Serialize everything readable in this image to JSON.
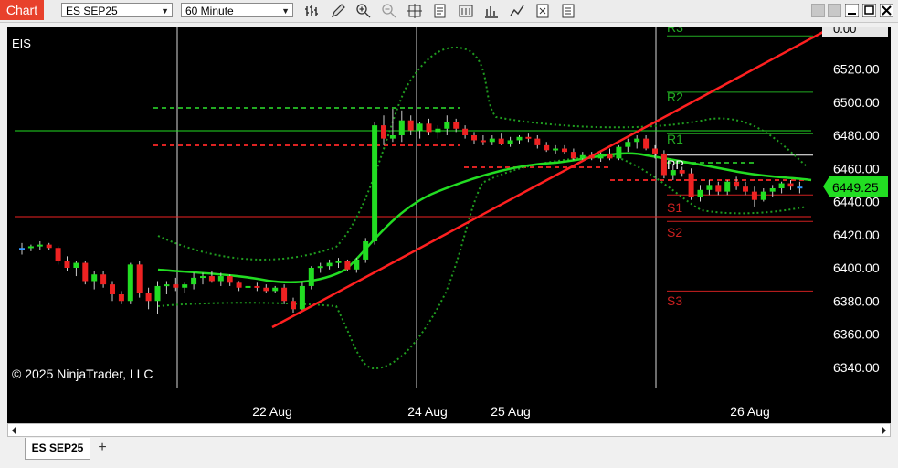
{
  "window": {
    "title": "Chart",
    "instrument": "ES SEP25",
    "interval": "60 Minute",
    "tab_label": "ES SEP25",
    "add_tab": "+"
  },
  "toolbar_icons": [
    "bars-icon",
    "pencil-icon",
    "zoom-in-icon",
    "zoom-out-icon",
    "crosshair-icon",
    "data-box-icon",
    "properties-icon",
    "strategies-icon",
    "indicators-icon",
    "templates-icon",
    "share-icon"
  ],
  "chart": {
    "label": "EIS",
    "copyright": "© 2025 NinjaTrader, LLC",
    "price_ticks": [
      "6520.00",
      "6500.00",
      "6480.00",
      "6460.00",
      "6440.00",
      "6420.00",
      "6400.00",
      "6380.00",
      "6360.00",
      "6340.00"
    ],
    "top_tick": "0.00",
    "current_price": "6449.25",
    "date_labels": [
      "22 Aug",
      "24 Aug",
      "25 Aug",
      "26 Aug"
    ],
    "pivot_labels": [
      "R3",
      "R2",
      "R1",
      "PP",
      "S1",
      "S2",
      "S3"
    ],
    "colors": {
      "background": "#000000",
      "up": "#22dd22",
      "down": "#ee2222",
      "neutral": "#3399ff",
      "ma": "#22dd22",
      "band": "#1f9c1f",
      "trendline": "#ff2020",
      "resistance": "#22aa22",
      "support": "#cc2020"
    }
  },
  "chart_data": {
    "type": "candlestick",
    "instrument": "ES SEP25",
    "interval": "60 Minute",
    "ylim": [
      6330,
      6530
    ],
    "ohlc": [
      [
        6412,
        6415,
        6408,
        6412
      ],
      [
        6412,
        6414,
        6410,
        6413
      ],
      [
        6413,
        6416,
        6411,
        6414
      ],
      [
        6414,
        6415,
        6411,
        6412
      ],
      [
        6412,
        6413,
        6402,
        6404
      ],
      [
        6404,
        6407,
        6398,
        6400
      ],
      [
        6400,
        6404,
        6395,
        6403
      ],
      [
        6403,
        6404,
        6390,
        6392
      ],
      [
        6392,
        6398,
        6387,
        6396
      ],
      [
        6396,
        6398,
        6388,
        6390
      ],
      [
        6390,
        6392,
        6380,
        6384
      ],
      [
        6384,
        6386,
        6378,
        6380
      ],
      [
        6380,
        6403,
        6378,
        6402
      ],
      [
        6402,
        6404,
        6382,
        6385
      ],
      [
        6385,
        6388,
        6375,
        6380
      ],
      [
        6380,
        6392,
        6372,
        6389
      ],
      [
        6389,
        6392,
        6384,
        6390
      ],
      [
        6390,
        6394,
        6386,
        6388
      ],
      [
        6388,
        6391,
        6385,
        6390
      ],
      [
        6390,
        6397,
        6387,
        6394
      ],
      [
        6394,
        6397,
        6390,
        6395
      ],
      [
        6395,
        6398,
        6391,
        6392
      ],
      [
        6392,
        6397,
        6389,
        6395
      ],
      [
        6395,
        6396,
        6389,
        6391
      ],
      [
        6391,
        6392,
        6386,
        6388
      ],
      [
        6388,
        6391,
        6386,
        6389
      ],
      [
        6389,
        6391,
        6386,
        6388
      ],
      [
        6388,
        6390,
        6385,
        6386
      ],
      [
        6386,
        6389,
        6385,
        6388
      ],
      [
        6388,
        6390,
        6378,
        6380
      ],
      [
        6380,
        6382,
        6373,
        6375
      ],
      [
        6375,
        6391,
        6374,
        6389
      ],
      [
        6389,
        6401,
        6387,
        6400
      ],
      [
        6400,
        6403,
        6397,
        6401
      ],
      [
        6401,
        6405,
        6399,
        6403
      ],
      [
        6403,
        6406,
        6400,
        6404
      ],
      [
        6404,
        6405,
        6398,
        6399
      ],
      [
        6399,
        6406,
        6397,
        6405
      ],
      [
        6405,
        6418,
        6403,
        6416
      ],
      [
        6416,
        6488,
        6414,
        6486
      ],
      [
        6486,
        6492,
        6474,
        6478
      ],
      [
        6478,
        6496,
        6476,
        6480
      ],
      [
        6480,
        6495,
        6476,
        6489
      ],
      [
        6489,
        6492,
        6480,
        6483
      ],
      [
        6483,
        6488,
        6478,
        6487
      ],
      [
        6487,
        6490,
        6480,
        6482
      ],
      [
        6482,
        6486,
        6478,
        6484
      ],
      [
        6484,
        6492,
        6480,
        6488
      ],
      [
        6488,
        6490,
        6482,
        6484
      ],
      [
        6484,
        6486,
        6478,
        6480
      ],
      [
        6480,
        6482,
        6475,
        6477
      ],
      [
        6477,
        6480,
        6474,
        6476
      ],
      [
        6476,
        6480,
        6474,
        6478
      ],
      [
        6478,
        6481,
        6474,
        6475
      ],
      [
        6475,
        6479,
        6473,
        6477
      ],
      [
        6477,
        6480,
        6475,
        6479
      ],
      [
        6479,
        6481,
        6476,
        6478
      ],
      [
        6478,
        6480,
        6472,
        6474
      ],
      [
        6474,
        6476,
        6470,
        6471
      ],
      [
        6471,
        6474,
        6469,
        6472
      ],
      [
        6472,
        6474,
        6469,
        6470
      ],
      [
        6470,
        6472,
        6465,
        6466
      ],
      [
        6466,
        6470,
        6464,
        6468
      ],
      [
        6468,
        6470,
        6465,
        6466
      ],
      [
        6466,
        6470,
        6464,
        6469
      ],
      [
        6469,
        6472,
        6465,
        6466
      ],
      [
        6466,
        6474,
        6465,
        6473
      ],
      [
        6473,
        6478,
        6470,
        6476
      ],
      [
        6476,
        6480,
        6472,
        6478
      ],
      [
        6478,
        6480,
        6471,
        6472
      ],
      [
        6472,
        6474,
        6466,
        6469
      ],
      [
        6469,
        6471,
        6454,
        6456
      ],
      [
        6456,
        6462,
        6453,
        6459
      ],
      [
        6459,
        6461,
        6455,
        6457
      ],
      [
        6457,
        6460,
        6441,
        6443
      ],
      [
        6443,
        6450,
        6440,
        6447
      ],
      [
        6447,
        6453,
        6444,
        6450
      ],
      [
        6450,
        6452,
        6444,
        6446
      ],
      [
        6446,
        6453,
        6444,
        6452
      ],
      [
        6452,
        6455,
        6447,
        6449
      ],
      [
        6449,
        6452,
        6444,
        6446
      ],
      [
        6446,
        6449,
        6437,
        6441
      ],
      [
        6441,
        6448,
        6440,
        6446
      ],
      [
        6446,
        6450,
        6443,
        6448
      ],
      [
        6448,
        6452,
        6445,
        6451
      ],
      [
        6451,
        6453,
        6447,
        6449
      ],
      [
        6449,
        6452,
        6445,
        6449
      ]
    ],
    "current_price": 6449.25,
    "pivot_levels": {
      "R3": 6540,
      "R2": 6506,
      "R1": 6481,
      "PP": 6468,
      "S1": 6444,
      "S2": 6428,
      "S3": 6386
    },
    "date_labels": [
      "22 Aug",
      "24 Aug",
      "25 Aug",
      "26 Aug"
    ]
  }
}
